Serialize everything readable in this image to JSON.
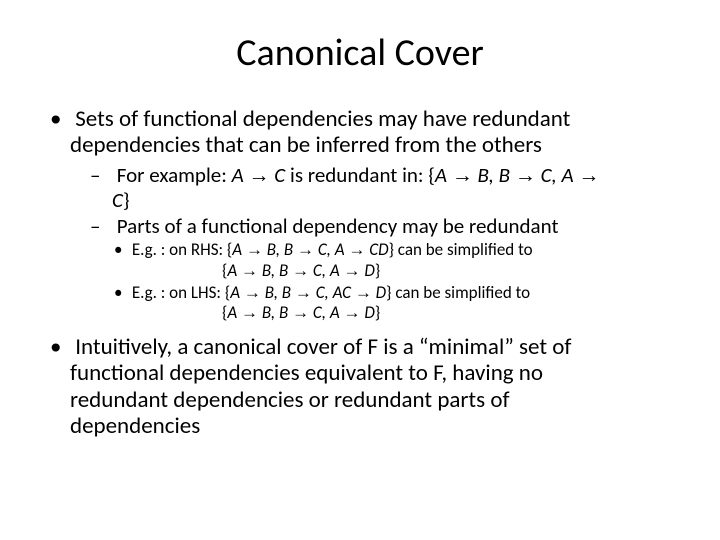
{
  "title": "Canonical Cover",
  "bullets": {
    "b1_a": "Sets of functional dependencies may have redundant",
    "b1_b": "dependencies that can be inferred from the others",
    "b1_1_a": "For example:  ",
    "b1_1_b": "A ",
    "b1_1_c": " C",
    "b1_1_d": " is redundant in:  {",
    "b1_1_e": "A ",
    "b1_1_f": " B,   B ",
    "b1_1_g": " C, A ",
    "b1_1_cont": "C",
    "b1_1_h": "}",
    "b1_2": "Parts of a functional dependency may be redundant",
    "b1_2_1_a": "E.g. : on RHS:   {",
    "b1_2_1_b": "A ",
    "b1_2_1_c": " B,   B ",
    "b1_2_1_d": " C,   A ",
    "b1_2_1_e": " CD",
    "b1_2_1_f": "}  can be simplified to",
    "b1_2_1_cont_a": "{",
    "b1_2_1_cont_b": "A ",
    "b1_2_1_cont_c": " B,  B ",
    "b1_2_1_cont_d": " C,  A ",
    "b1_2_1_cont_e": " D",
    "b1_2_1_cont_f": "}",
    "b1_2_2_a": "E.g. : on LHS:    {",
    "b1_2_2_b": "A ",
    "b1_2_2_c": " B,   B ",
    "b1_2_2_d": " C,   AC ",
    "b1_2_2_e": " D",
    "b1_2_2_f": "}  can be simplified to",
    "b1_2_2_cont_a": "{",
    "b1_2_2_cont_b": "A ",
    "b1_2_2_cont_c": " B,  B ",
    "b1_2_2_cont_d": " C,  A ",
    "b1_2_2_cont_e": " D",
    "b1_2_2_cont_f": "}",
    "b2_a": "Intuitively, a canonical cover of F is a “minimal” set of",
    "b2_b": "functional dependencies equivalent to F, having no",
    "b2_c": "redundant dependencies or redundant parts of",
    "b2_d": "dependencies"
  },
  "glyphs": {
    "arrow": "→"
  }
}
